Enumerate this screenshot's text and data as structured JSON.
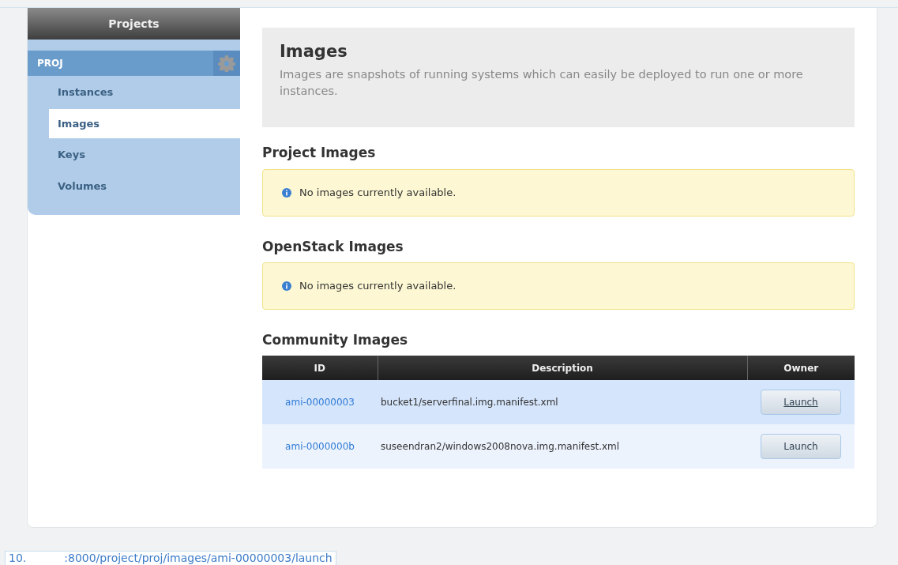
{
  "sidebar": {
    "title": "Projects",
    "project": "PROJ",
    "items": [
      {
        "label": "Instances",
        "selected": false
      },
      {
        "label": "Images",
        "selected": true
      },
      {
        "label": "Keys",
        "selected": false
      },
      {
        "label": "Volumes",
        "selected": false
      }
    ]
  },
  "page_header": {
    "title": "Images",
    "description": "Images are snapshots of running systems which can easily be deployed to run one or more instances."
  },
  "sections": [
    {
      "title": "Project Images",
      "kind": "alert",
      "message": "No images currently available."
    },
    {
      "title": "OpenStack Images",
      "kind": "alert",
      "message": "No images currently available."
    },
    {
      "title": "Community Images",
      "kind": "table",
      "columns": [
        "ID",
        "Description",
        "Owner"
      ],
      "rows": [
        {
          "id": "ami-00000003",
          "description": "bucket1/serverfinal.img.manifest.xml",
          "action": "Launch",
          "hovered": true
        },
        {
          "id": "ami-0000000b",
          "description": "suseendran2/windows2008nova.img.manifest.xml",
          "action": "Launch",
          "hovered": false
        }
      ]
    }
  ],
  "status_bar": {
    "host": "10.",
    "path": ":8000/project/proj/images/ami-00000003/launch"
  }
}
